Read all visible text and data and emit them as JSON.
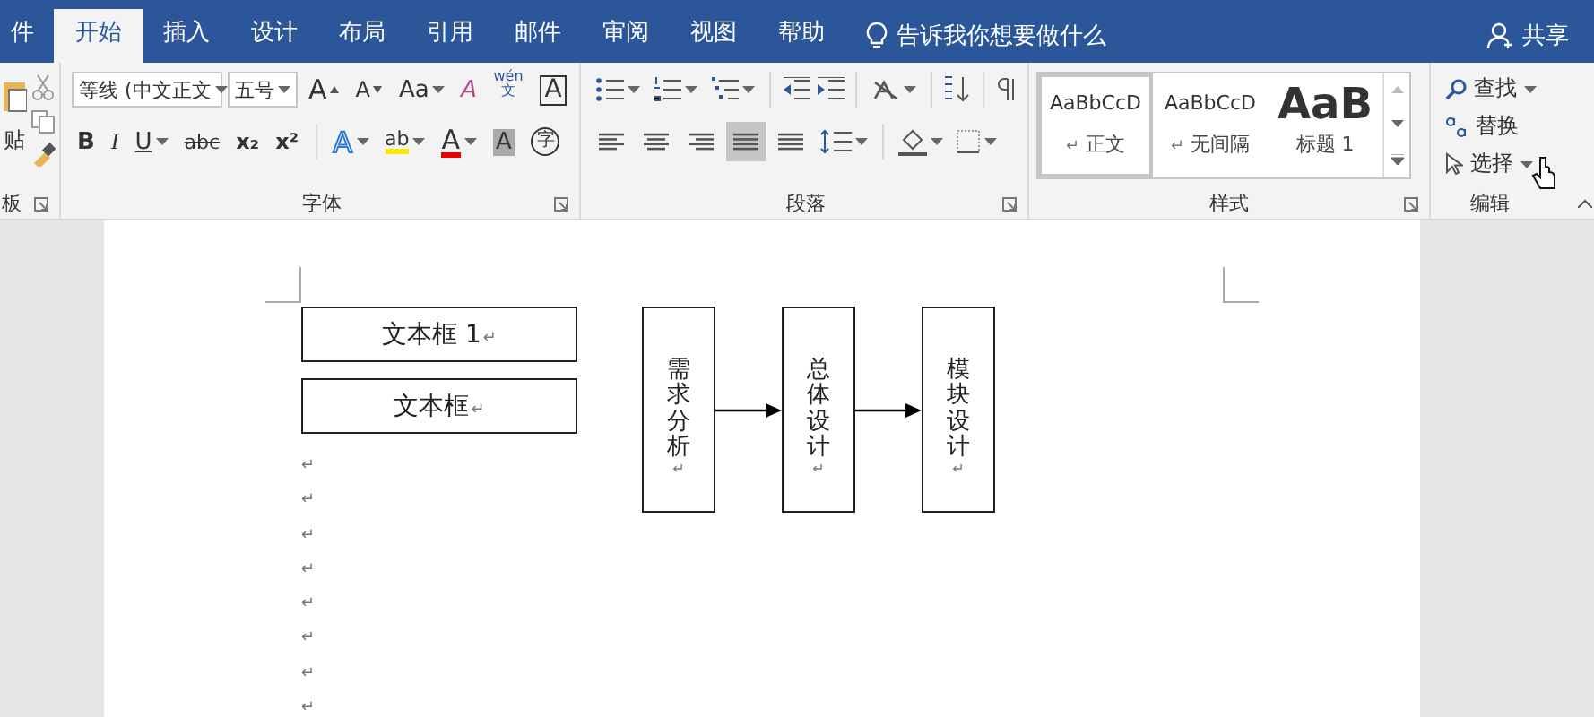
{
  "tabs": [
    {
      "label": "件",
      "selected": false
    },
    {
      "label": "开始",
      "selected": true
    },
    {
      "label": "插入",
      "selected": false
    },
    {
      "label": "设计",
      "selected": false
    },
    {
      "label": "布局",
      "selected": false
    },
    {
      "label": "引用",
      "selected": false
    },
    {
      "label": "邮件",
      "selected": false
    },
    {
      "label": "审阅",
      "selected": false
    },
    {
      "label": "视图",
      "selected": false
    },
    {
      "label": "帮助",
      "selected": false
    }
  ],
  "tell_me": "告诉我你想要做什么",
  "share": "共享",
  "clipboard": {
    "paste_label": "贴",
    "group_label": "板"
  },
  "font": {
    "font_name": "等线 (中文正文",
    "font_size": "五号",
    "top_buttons": [
      {
        "kind": "grow",
        "glyph": "A"
      },
      {
        "kind": "shrink",
        "glyph": "A"
      },
      {
        "kind": "case",
        "glyph": "Aa"
      },
      {
        "kind": "clear",
        "glyph": "A"
      },
      {
        "kind": "phonetic",
        "glyph": "wén",
        "sub": "文"
      },
      {
        "kind": "border",
        "glyph": "A"
      }
    ],
    "format_buttons": [
      {
        "kind": "bold",
        "glyph": "B"
      },
      {
        "kind": "italic",
        "glyph": "I"
      },
      {
        "kind": "underline",
        "glyph": "U"
      },
      {
        "kind": "strike",
        "glyph": "abc"
      },
      {
        "kind": "sub",
        "glyph": "x₂"
      },
      {
        "kind": "sup",
        "glyph": "x²"
      }
    ],
    "effect_buttons": [
      {
        "kind": "effects",
        "glyph": "A"
      },
      {
        "kind": "highlight",
        "glyph": "ab"
      },
      {
        "kind": "color",
        "glyph": "A"
      },
      {
        "kind": "shading",
        "glyph": "A"
      },
      {
        "kind": "enclose",
        "glyph": "字"
      }
    ],
    "group_label": "字体"
  },
  "paragraph": {
    "alignments": [
      {
        "kind": "left",
        "selected": false
      },
      {
        "kind": "center",
        "selected": false
      },
      {
        "kind": "right",
        "selected": false
      },
      {
        "kind": "justify",
        "selected": true
      },
      {
        "kind": "distributed",
        "selected": false
      }
    ],
    "group_label": "段落"
  },
  "styles": {
    "items": [
      {
        "kind": "normal",
        "sample": "AaBbCcD",
        "mark": "↵",
        "name": "正文",
        "selected": true
      },
      {
        "kind": "normal",
        "sample": "AaBbCcD",
        "mark": "↵",
        "name": "无间隔",
        "selected": false
      },
      {
        "kind": "heading",
        "sample": "AaB",
        "name": "标题 1",
        "selected": false
      }
    ],
    "group_label": "样式"
  },
  "editing": {
    "commands": [
      {
        "kind": "find",
        "label": "查找"
      },
      {
        "kind": "replace",
        "label": "替换"
      },
      {
        "kind": "select",
        "label": "选择"
      }
    ],
    "group_label": "编辑"
  },
  "document": {
    "text_boxes": [
      {
        "text": "文本框 1",
        "mark": "↵"
      },
      {
        "text": "文本框",
        "mark": "↵"
      }
    ],
    "empty_paragraphs": [
      "↵",
      "↵",
      "↵",
      "↵",
      "↵",
      "↵",
      "↵",
      "↵"
    ],
    "flow_steps": [
      {
        "text": "需求分析",
        "mark": "↵"
      },
      {
        "text": "总体设计",
        "mark": "↵"
      },
      {
        "text": "模块设计",
        "mark": "↵"
      }
    ]
  }
}
